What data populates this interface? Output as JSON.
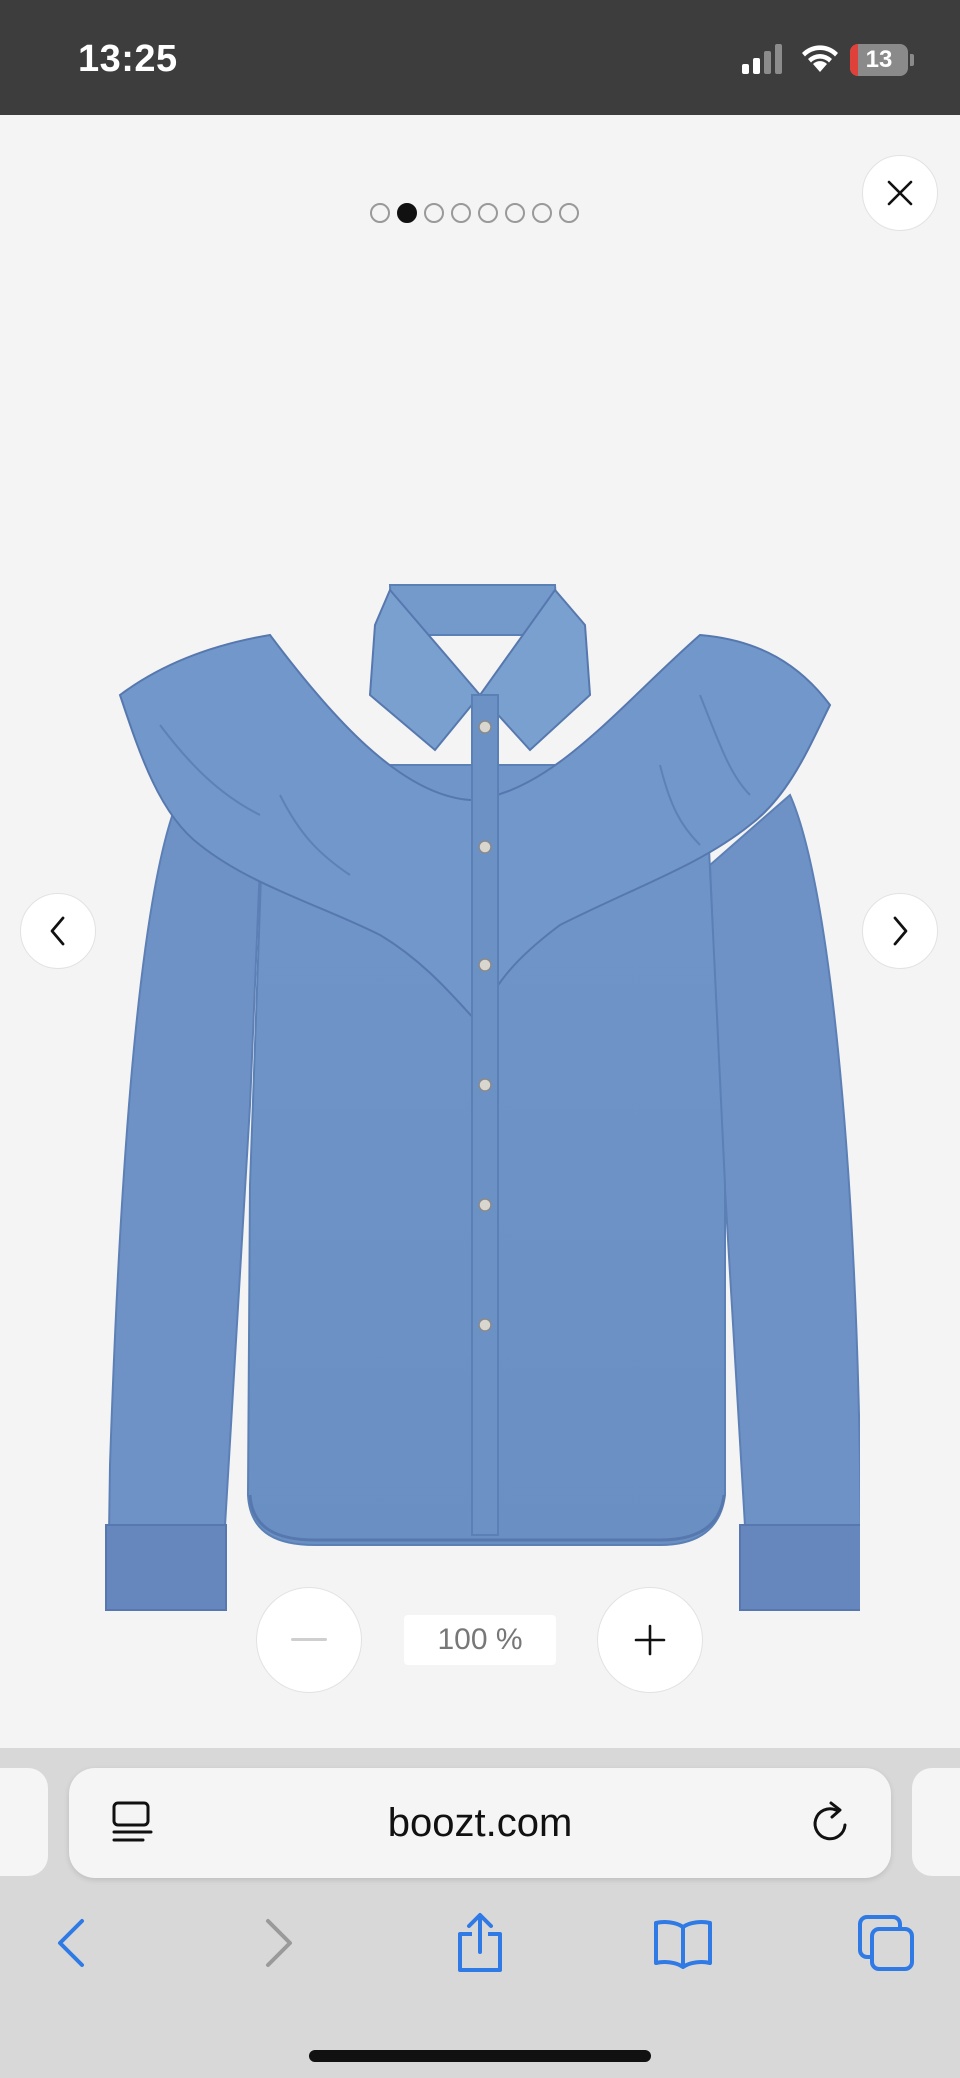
{
  "status_bar": {
    "time": "13:25",
    "battery_level": "13",
    "battery_fraction": 0.13,
    "battery_color": "#e0403a",
    "icons": [
      "cellular-signal-icon",
      "wifi-icon",
      "battery-icon"
    ]
  },
  "viewer": {
    "image_count": 8,
    "active_index": 1,
    "zoom_level": "100 %",
    "denim_color": "#6f93c7",
    "icons": [
      "close-icon",
      "chevron-left-icon",
      "chevron-right-icon",
      "minus-icon",
      "plus-icon"
    ]
  },
  "browser": {
    "url": "boozt.com",
    "accent_color": "#2f7ae5",
    "icons": [
      "reader-view-icon",
      "reload-icon",
      "back-icon",
      "forward-icon",
      "share-icon",
      "bookmarks-icon",
      "tabs-icon"
    ]
  }
}
